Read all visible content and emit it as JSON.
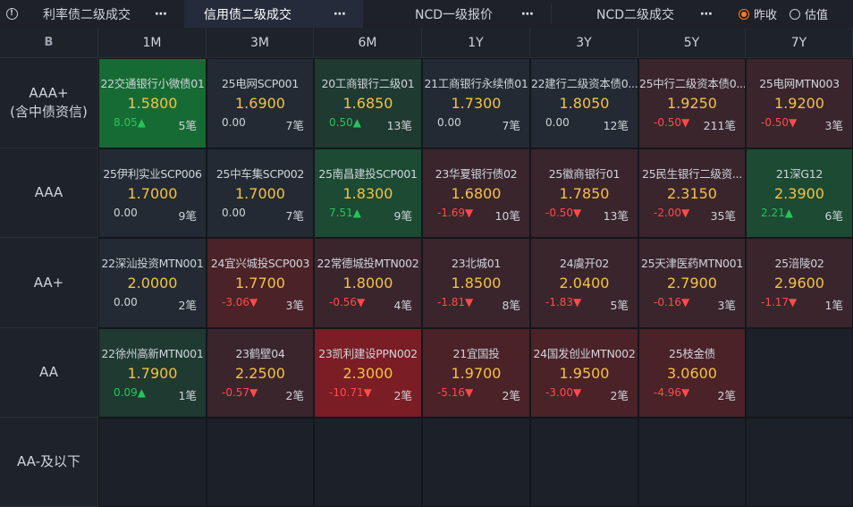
{
  "tabs": [
    {
      "label": "利率债二级成交",
      "more": "⋯",
      "active": false
    },
    {
      "label": "信用债二级成交",
      "more": "⋯",
      "active": true
    },
    {
      "label": "NCD一级报价",
      "more": "⋯",
      "active": false
    },
    {
      "label": "NCD二级成交",
      "more": "⋯",
      "active": false
    }
  ],
  "radio": [
    {
      "label": "昨收",
      "selected": true
    },
    {
      "label": "估值",
      "selected": false
    }
  ],
  "corner_label": "B",
  "columns": [
    "1M",
    "3M",
    "6M",
    "1Y",
    "3Y",
    "5Y",
    "7Y"
  ],
  "rows": [
    {
      "label": [
        "AAA+",
        "(含中债资信)"
      ]
    },
    {
      "label": [
        "AAA"
      ]
    },
    {
      "label": [
        "AA+"
      ]
    },
    {
      "label": [
        "AA"
      ]
    },
    {
      "label": [
        "AA-及以下"
      ]
    }
  ],
  "colors": {
    "up_strong": "#166b34",
    "up_mid": "#1c4a33",
    "up_weak": "#1f3a30",
    "neutral": "#232a33",
    "down_weak": "#3a252c",
    "down_mid": "#4a2228",
    "down_strong": "#7a1d24",
    "yield": "#f3c246",
    "up_text": "#27c45a",
    "down_text": "#ff4a4a"
  },
  "cells": [
    [
      {
        "name": "22交通银行小微债01",
        "yield": "1.5800",
        "chg": "8.05▲",
        "dir": "up",
        "cnt": "5笔",
        "bg": "up_strong"
      },
      {
        "name": "25电网SCP001",
        "yield": "1.6900",
        "chg": "0.00",
        "dir": "flat",
        "cnt": "7笔",
        "bg": "neutral"
      },
      {
        "name": "20工商银行二级01",
        "yield": "1.6850",
        "chg": "0.50▲",
        "dir": "up",
        "cnt": "13笔",
        "bg": "up_weak"
      },
      {
        "name": "21工商银行永续债01",
        "yield": "1.7300",
        "chg": "0.00",
        "dir": "flat",
        "cnt": "7笔",
        "bg": "neutral"
      },
      {
        "name": "22建行二级资本债0...",
        "yield": "1.8050",
        "chg": "0.00",
        "dir": "flat",
        "cnt": "12笔",
        "bg": "neutral"
      },
      {
        "name": "25中行二级资本债0...",
        "yield": "1.9250",
        "chg": "-0.50▼",
        "dir": "down",
        "cnt": "211笔",
        "bg": "down_weak"
      },
      {
        "name": "25电网MTN003",
        "yield": "1.9200",
        "chg": "-0.50▼",
        "dir": "down",
        "cnt": "3笔",
        "bg": "down_weak"
      }
    ],
    [
      {
        "name": "25伊利实业SCP006",
        "yield": "1.7000",
        "chg": "0.00",
        "dir": "flat",
        "cnt": "9笔",
        "bg": "neutral"
      },
      {
        "name": "25中车集SCP002",
        "yield": "1.7000",
        "chg": "0.00",
        "dir": "flat",
        "cnt": "7笔",
        "bg": "neutral"
      },
      {
        "name": "25南昌建投SCP001",
        "yield": "1.8300",
        "chg": "7.51▲",
        "dir": "up",
        "cnt": "9笔",
        "bg": "up_mid"
      },
      {
        "name": "23华夏银行债02",
        "yield": "1.6800",
        "chg": "-1.69▼",
        "dir": "down",
        "cnt": "10笔",
        "bg": "down_weak"
      },
      {
        "name": "25徽商银行01",
        "yield": "1.7850",
        "chg": "-0.50▼",
        "dir": "down",
        "cnt": "13笔",
        "bg": "down_weak"
      },
      {
        "name": "25民生银行二级资...",
        "yield": "2.3150",
        "chg": "-2.00▼",
        "dir": "down",
        "cnt": "35笔",
        "bg": "down_weak"
      },
      {
        "name": "21深G12",
        "yield": "2.3900",
        "chg": "2.21▲",
        "dir": "up",
        "cnt": "6笔",
        "bg": "up_mid"
      }
    ],
    [
      {
        "name": "22深汕投资MTN001",
        "yield": "2.0000",
        "chg": "0.00",
        "dir": "flat",
        "cnt": "2笔",
        "bg": "neutral"
      },
      {
        "name": "24宜兴城投SCP003",
        "yield": "1.7700",
        "chg": "-3.06▼",
        "dir": "down",
        "cnt": "3笔",
        "bg": "down_mid"
      },
      {
        "name": "22常德城投MTN002",
        "yield": "1.8000",
        "chg": "-0.56▼",
        "dir": "down",
        "cnt": "4笔",
        "bg": "down_weak"
      },
      {
        "name": "23北城01",
        "yield": "1.8500",
        "chg": "-1.81▼",
        "dir": "down",
        "cnt": "8笔",
        "bg": "down_weak"
      },
      {
        "name": "24虞开02",
        "yield": "2.0400",
        "chg": "-1.83▼",
        "dir": "down",
        "cnt": "5笔",
        "bg": "down_weak"
      },
      {
        "name": "25天津医药MTN001",
        "yield": "2.7900",
        "chg": "-0.16▼",
        "dir": "down",
        "cnt": "3笔",
        "bg": "down_weak"
      },
      {
        "name": "25涪陵02",
        "yield": "2.9600",
        "chg": "-1.17▼",
        "dir": "down",
        "cnt": "1笔",
        "bg": "down_weak"
      }
    ],
    [
      {
        "name": "22徐州高新MTN001",
        "yield": "1.7900",
        "chg": "0.09▲",
        "dir": "up",
        "cnt": "1笔",
        "bg": "up_weak"
      },
      {
        "name": "23鹤壁04",
        "yield": "2.2500",
        "chg": "-0.57▼",
        "dir": "down",
        "cnt": "2笔",
        "bg": "down_weak"
      },
      {
        "name": "23凯利建设PPN002",
        "yield": "2.3000",
        "chg": "-10.71▼",
        "dir": "down",
        "cnt": "2笔",
        "bg": "down_strong"
      },
      {
        "name": "21宜国投",
        "yield": "1.9700",
        "chg": "-5.16▼",
        "dir": "down",
        "cnt": "2笔",
        "bg": "down_mid"
      },
      {
        "name": "24国发创业MTN002",
        "yield": "1.9500",
        "chg": "-3.00▼",
        "dir": "down",
        "cnt": "2笔",
        "bg": "down_mid"
      },
      {
        "name": "25枝金债",
        "yield": "3.0600",
        "chg": "-4.96▼",
        "dir": "down",
        "cnt": "2笔",
        "bg": "down_mid"
      },
      null
    ],
    [
      null,
      null,
      null,
      null,
      null,
      null,
      null
    ]
  ]
}
